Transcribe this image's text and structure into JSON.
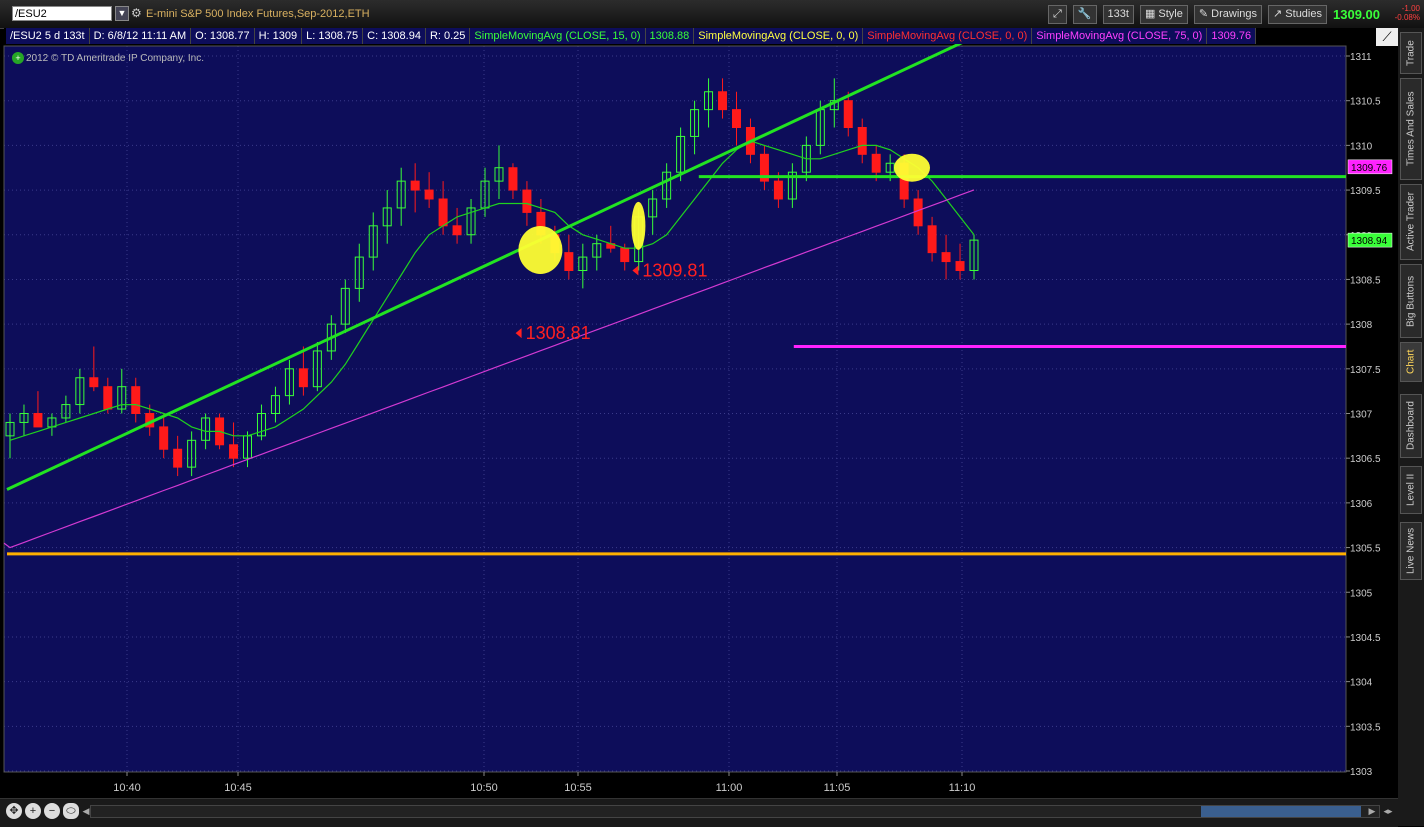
{
  "header": {
    "symbol": "/ESU2",
    "description": "E-mini S&P 500 Index Futures,Sep-2012,ETH",
    "tick_aggregation": "133t",
    "style_label": "Style",
    "drawings_label": "Drawings",
    "studies_label": "Studies",
    "last_price": "1309.00",
    "net_change": "-1.00",
    "pct_change": "-0.08%"
  },
  "status": {
    "symbol_period": "/ESU2 5 d 133t",
    "date": "D: 6/8/12 11:11 AM",
    "open": "O: 1308.77",
    "high": "H: 1309",
    "low": "L: 1308.75",
    "close": "C: 1308.94",
    "range": "R: 0.25",
    "sma15_label": "SimpleMovingAvg (CLOSE, 15, 0)",
    "sma15_value": "1308.88",
    "sma0a_label": "SimpleMovingAvg (CLOSE, 0, 0)",
    "sma0b_label": "SimpleMovingAvg (CLOSE, 0, 0)",
    "sma75_label": "SimpleMovingAvg (CLOSE, 75, 0)",
    "sma75_value": "1309.76"
  },
  "copyright": "2012 © TD Ameritrade IP Company, Inc.",
  "side_tabs": [
    "Trade",
    "Times And Sales",
    "Active Trader",
    "Big Buttons",
    "Chart",
    "Dashboard",
    "Level II",
    "Live News"
  ],
  "active_tab": "Chart",
  "colors": {
    "plot_bg": "#0d0d5a",
    "up": "#39ff39",
    "down": "#ff1a1a",
    "sma15": "#1fd21f",
    "sma75": "#d23ad2",
    "trendline": "#22e322",
    "support": "#ffb000",
    "magenta_line": "#ff22ff",
    "annotation": "#ff2020",
    "highlight": "#ffff33"
  },
  "chart_data": {
    "type": "candlestick",
    "ylim": [
      1303,
      1311.2
    ],
    "y_ticks": [
      "1303",
      "1303.5",
      "1304",
      "1304.5",
      "1305",
      "1305.5",
      "1306",
      "1306.5",
      "1307",
      "1307.5",
      "1308",
      "1308.5",
      "1309",
      "1309.5",
      "1310",
      "1310.5",
      "1311"
    ],
    "x_labels": [
      "10:40",
      "10:45",
      "10:50",
      "10:55",
      "11:00",
      "11:05",
      "11:10"
    ],
    "price_bubbles": [
      {
        "value": "1309.76",
        "price": 1309.76,
        "color": "#ff22ff"
      },
      {
        "value": "1308.94",
        "price": 1308.94,
        "color": "#39ff39"
      }
    ],
    "annotations": [
      {
        "text": "1308.81",
        "at": "10:52",
        "price": 1307.9
      },
      {
        "text": "1309.81",
        "at": "10:57",
        "price": 1308.6
      }
    ],
    "horizontal_lines": [
      {
        "price": 1309.65,
        "from": "10:59",
        "color": "#22e322"
      },
      {
        "price": 1307.75,
        "from": "11:03",
        "color": "#ff22ff"
      },
      {
        "price": 1305.43,
        "from": "10:36",
        "color": "#ffb000"
      }
    ],
    "trendline": {
      "from": [
        "10:36",
        1306.15
      ],
      "to": [
        "11:10",
        1311.15
      ]
    },
    "highlights": [
      {
        "at": "10:53",
        "price": 1308.83
      },
      {
        "at": "10:57",
        "price": 1309.1
      },
      {
        "at": "11:08",
        "price": 1309.75
      }
    ],
    "candles": [
      {
        "o": 1306.75,
        "h": 1307.0,
        "l": 1306.5,
        "c": 1306.9
      },
      {
        "o": 1306.9,
        "h": 1307.1,
        "l": 1306.75,
        "c": 1307.0
      },
      {
        "o": 1307.0,
        "h": 1307.25,
        "l": 1306.9,
        "c": 1306.85
      },
      {
        "o": 1306.85,
        "h": 1307.0,
        "l": 1306.75,
        "c": 1306.95
      },
      {
        "o": 1306.95,
        "h": 1307.2,
        "l": 1306.9,
        "c": 1307.1
      },
      {
        "o": 1307.1,
        "h": 1307.5,
        "l": 1307.0,
        "c": 1307.4
      },
      {
        "o": 1307.4,
        "h": 1307.75,
        "l": 1307.25,
        "c": 1307.3
      },
      {
        "o": 1307.3,
        "h": 1307.4,
        "l": 1307.0,
        "c": 1307.05
      },
      {
        "o": 1307.05,
        "h": 1307.5,
        "l": 1307.0,
        "c": 1307.3
      },
      {
        "o": 1307.3,
        "h": 1307.4,
        "l": 1306.9,
        "c": 1307.0
      },
      {
        "o": 1307.0,
        "h": 1307.1,
        "l": 1306.75,
        "c": 1306.85
      },
      {
        "o": 1306.85,
        "h": 1307.0,
        "l": 1306.5,
        "c": 1306.6
      },
      {
        "o": 1306.6,
        "h": 1306.75,
        "l": 1306.3,
        "c": 1306.4
      },
      {
        "o": 1306.4,
        "h": 1306.8,
        "l": 1306.3,
        "c": 1306.7
      },
      {
        "o": 1306.7,
        "h": 1307.0,
        "l": 1306.6,
        "c": 1306.95
      },
      {
        "o": 1306.95,
        "h": 1307.0,
        "l": 1306.6,
        "c": 1306.65
      },
      {
        "o": 1306.65,
        "h": 1306.9,
        "l": 1306.4,
        "c": 1306.5
      },
      {
        "o": 1306.5,
        "h": 1306.8,
        "l": 1306.4,
        "c": 1306.75
      },
      {
        "o": 1306.75,
        "h": 1307.1,
        "l": 1306.7,
        "c": 1307.0
      },
      {
        "o": 1307.0,
        "h": 1307.3,
        "l": 1306.9,
        "c": 1307.2
      },
      {
        "o": 1307.2,
        "h": 1307.6,
        "l": 1307.1,
        "c": 1307.5
      },
      {
        "o": 1307.5,
        "h": 1307.75,
        "l": 1307.2,
        "c": 1307.3
      },
      {
        "o": 1307.3,
        "h": 1307.8,
        "l": 1307.25,
        "c": 1307.7
      },
      {
        "o": 1307.7,
        "h": 1308.1,
        "l": 1307.6,
        "c": 1308.0
      },
      {
        "o": 1308.0,
        "h": 1308.5,
        "l": 1307.9,
        "c": 1308.4
      },
      {
        "o": 1308.4,
        "h": 1308.9,
        "l": 1308.25,
        "c": 1308.75
      },
      {
        "o": 1308.75,
        "h": 1309.25,
        "l": 1308.6,
        "c": 1309.1
      },
      {
        "o": 1309.1,
        "h": 1309.5,
        "l": 1308.9,
        "c": 1309.3
      },
      {
        "o": 1309.3,
        "h": 1309.75,
        "l": 1309.1,
        "c": 1309.6
      },
      {
        "o": 1309.6,
        "h": 1309.8,
        "l": 1309.25,
        "c": 1309.5
      },
      {
        "o": 1309.5,
        "h": 1309.7,
        "l": 1309.3,
        "c": 1309.4
      },
      {
        "o": 1309.4,
        "h": 1309.6,
        "l": 1309.0,
        "c": 1309.1
      },
      {
        "o": 1309.1,
        "h": 1309.3,
        "l": 1308.9,
        "c": 1309.0
      },
      {
        "o": 1309.0,
        "h": 1309.4,
        "l": 1308.9,
        "c": 1309.3
      },
      {
        "o": 1309.3,
        "h": 1309.75,
        "l": 1309.2,
        "c": 1309.6
      },
      {
        "o": 1309.6,
        "h": 1310.0,
        "l": 1309.4,
        "c": 1309.75
      },
      {
        "o": 1309.75,
        "h": 1309.8,
        "l": 1309.4,
        "c": 1309.5
      },
      {
        "o": 1309.5,
        "h": 1309.6,
        "l": 1309.1,
        "c": 1309.25
      },
      {
        "o": 1309.25,
        "h": 1309.4,
        "l": 1308.9,
        "c": 1309.0
      },
      {
        "o": 1309.0,
        "h": 1309.1,
        "l": 1308.7,
        "c": 1308.8
      },
      {
        "o": 1308.8,
        "h": 1309.0,
        "l": 1308.5,
        "c": 1308.6
      },
      {
        "o": 1308.6,
        "h": 1308.9,
        "l": 1308.4,
        "c": 1308.75
      },
      {
        "o": 1308.75,
        "h": 1309.0,
        "l": 1308.6,
        "c": 1308.9
      },
      {
        "o": 1308.9,
        "h": 1309.1,
        "l": 1308.8,
        "c": 1308.85
      },
      {
        "o": 1308.85,
        "h": 1308.9,
        "l": 1308.6,
        "c": 1308.7
      },
      {
        "o": 1308.7,
        "h": 1309.3,
        "l": 1308.6,
        "c": 1309.2
      },
      {
        "o": 1309.2,
        "h": 1309.5,
        "l": 1309.0,
        "c": 1309.4
      },
      {
        "o": 1309.4,
        "h": 1309.8,
        "l": 1309.3,
        "c": 1309.7
      },
      {
        "o": 1309.7,
        "h": 1310.2,
        "l": 1309.6,
        "c": 1310.1
      },
      {
        "o": 1310.1,
        "h": 1310.5,
        "l": 1309.9,
        "c": 1310.4
      },
      {
        "o": 1310.4,
        "h": 1310.75,
        "l": 1310.2,
        "c": 1310.6
      },
      {
        "o": 1310.6,
        "h": 1310.75,
        "l": 1310.3,
        "c": 1310.4
      },
      {
        "o": 1310.4,
        "h": 1310.6,
        "l": 1310.0,
        "c": 1310.2
      },
      {
        "o": 1310.2,
        "h": 1310.3,
        "l": 1309.8,
        "c": 1309.9
      },
      {
        "o": 1309.9,
        "h": 1310.0,
        "l": 1309.5,
        "c": 1309.6
      },
      {
        "o": 1309.6,
        "h": 1309.7,
        "l": 1309.3,
        "c": 1309.4
      },
      {
        "o": 1309.4,
        "h": 1309.8,
        "l": 1309.3,
        "c": 1309.7
      },
      {
        "o": 1309.7,
        "h": 1310.1,
        "l": 1309.6,
        "c": 1310.0
      },
      {
        "o": 1310.0,
        "h": 1310.5,
        "l": 1309.9,
        "c": 1310.4
      },
      {
        "o": 1310.4,
        "h": 1310.75,
        "l": 1310.2,
        "c": 1310.5
      },
      {
        "o": 1310.5,
        "h": 1310.6,
        "l": 1310.1,
        "c": 1310.2
      },
      {
        "o": 1310.2,
        "h": 1310.3,
        "l": 1309.8,
        "c": 1309.9
      },
      {
        "o": 1309.9,
        "h": 1310.0,
        "l": 1309.6,
        "c": 1309.7
      },
      {
        "o": 1309.7,
        "h": 1309.9,
        "l": 1309.6,
        "c": 1309.8
      },
      {
        "o": 1309.8,
        "h": 1309.9,
        "l": 1309.3,
        "c": 1309.4
      },
      {
        "o": 1309.4,
        "h": 1309.5,
        "l": 1309.0,
        "c": 1309.1
      },
      {
        "o": 1309.1,
        "h": 1309.2,
        "l": 1308.7,
        "c": 1308.8
      },
      {
        "o": 1308.8,
        "h": 1309.0,
        "l": 1308.5,
        "c": 1308.7
      },
      {
        "o": 1308.7,
        "h": 1308.9,
        "l": 1308.5,
        "c": 1308.6
      },
      {
        "o": 1308.6,
        "h": 1309.0,
        "l": 1308.5,
        "c": 1308.94
      }
    ],
    "sma15": [
      1306.7,
      1306.75,
      1306.8,
      1306.85,
      1306.9,
      1306.95,
      1307.0,
      1307.05,
      1307.1,
      1307.1,
      1307.05,
      1307.0,
      1306.95,
      1306.85,
      1306.8,
      1306.8,
      1306.75,
      1306.75,
      1306.8,
      1306.85,
      1306.95,
      1307.05,
      1307.2,
      1307.35,
      1307.55,
      1307.8,
      1308.05,
      1308.3,
      1308.55,
      1308.8,
      1309.0,
      1309.1,
      1309.2,
      1309.25,
      1309.3,
      1309.35,
      1309.35,
      1309.35,
      1309.3,
      1309.25,
      1309.1,
      1309.0,
      1308.95,
      1308.9,
      1308.85,
      1308.85,
      1308.9,
      1309.0,
      1309.2,
      1309.4,
      1309.6,
      1309.8,
      1309.95,
      1310.05,
      1310.0,
      1309.95,
      1309.9,
      1309.85,
      1309.85,
      1309.9,
      1309.95,
      1310.0,
      1310.0,
      1309.95,
      1309.85,
      1309.75,
      1309.6,
      1309.4,
      1309.2,
      1309.0
    ]
  }
}
